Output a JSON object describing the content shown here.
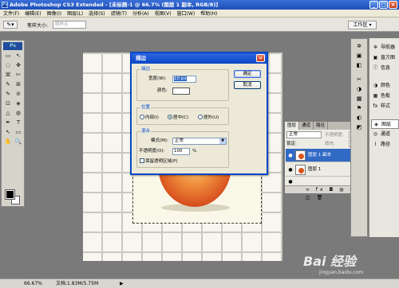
{
  "window": {
    "title": "Adobe Photoshop CS3 Extended - [未标题-1 @ 66.7% (图层 1 副本, RGB/8)]",
    "app_icon": "Ps",
    "minimize": "_",
    "maximize": "□",
    "close": "×"
  },
  "menu": [
    "文件(F)",
    "编辑(E)",
    "图像(I)",
    "图层(L)",
    "选择(S)",
    "滤镜(T)",
    "分析(A)",
    "视图(V)",
    "窗口(W)",
    "帮助(H)"
  ],
  "options_bar": {
    "brush_size_label": "笔样大小:",
    "sample_value": "取样点",
    "workspace": "工作区 ▾"
  },
  "tools": {
    "logo": "Ps",
    "icons": [
      "▭",
      "↖",
      "◌",
      "✥",
      "⌘",
      "✄",
      "✎",
      "⊞",
      "✎",
      "⊘",
      "⊡",
      "◈",
      "△",
      "◍",
      "✒",
      "T",
      "↖",
      "▭",
      "✋",
      "🔍"
    ]
  },
  "status_bar": {
    "zoom": "66.67%",
    "doc_info": "文档:1.83M/5.75M",
    "arrow": "▶"
  },
  "stroke_dialog": {
    "title": "描边",
    "close": "×",
    "stroke_group": "描边",
    "width_label": "宽度(W):",
    "width_value": "10 px",
    "color_label": "颜色:",
    "location_group": "位置",
    "loc_inside": "内部(I)",
    "loc_center": "居中(C)",
    "loc_outside": "居外(U)",
    "blend_group": "混合",
    "mode_label": "模式(M):",
    "mode_value": "正常",
    "opacity_label": "不透明度(O):",
    "opacity_value": "100",
    "opacity_unit": "%",
    "preserve_transparency": "保留透明区域(P)",
    "ok": "确定",
    "cancel": "取消"
  },
  "dock_icons": [
    "✲",
    "▣",
    "◧",
    "✂",
    "◑",
    "▦",
    "⚑",
    "◐",
    "◩"
  ],
  "panels": [
    {
      "icon": "✲",
      "label": "导航器"
    },
    {
      "icon": "▣",
      "label": "直方图"
    },
    {
      "icon": "ⓘ",
      "label": "信息"
    },
    {
      "icon": "◑",
      "label": "颜色"
    },
    {
      "icon": "▦",
      "label": "色板"
    },
    {
      "icon": "fx",
      "label": "样式"
    },
    {
      "icon": "◈",
      "label": "图层"
    },
    {
      "icon": "◎",
      "label": "通道"
    },
    {
      "icon": "⌇",
      "label": "路径"
    }
  ],
  "layers_panel": {
    "tabs": [
      "图层",
      "通道",
      "路径"
    ],
    "blend_mode": "正常",
    "opacity_label": "不透明度:",
    "lock_label": "锁定:",
    "fill_label": "填充:",
    "layers": [
      {
        "name": "图层 1 副本",
        "selected": true
      },
      {
        "name": "图层 1",
        "selected": false
      },
      {
        "name": "",
        "selected": false
      }
    ],
    "footer": "∞ fx ◘ ◍ ▭ ◫ 🗑"
  },
  "watermark": {
    "text": "Bai 经验",
    "url": "jingyan.baidu.com"
  },
  "colors": {
    "titlebar": "#1d4fb8",
    "selected_layer": "#316ac5",
    "dialog_border": "#0a47c8"
  }
}
